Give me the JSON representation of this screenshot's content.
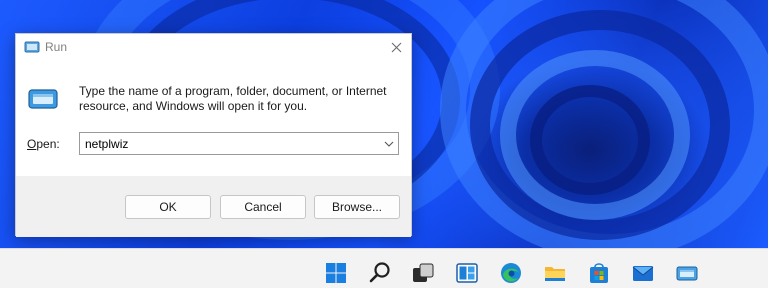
{
  "dialog": {
    "title": "Run",
    "description": "Type the name of a program, folder, document, or Internet resource, and Windows will open it for you.",
    "open_label_prefix": "",
    "open_label_accel": "O",
    "open_label_rest": "pen:",
    "open_value": "netplwiz",
    "ok_label": "OK",
    "cancel_label": "Cancel",
    "browse_label": "Browse..."
  },
  "taskbar": {
    "icons": [
      "start-icon",
      "search-icon",
      "task-view-icon",
      "widgets-icon",
      "edge-icon",
      "file-explorer-icon",
      "microsoft-store-icon",
      "mail-icon",
      "run-icon"
    ]
  },
  "colors": {
    "accent": "#0067c0",
    "wallpaper": "#0a3fd6",
    "taskbar": "#f3f3f3"
  }
}
